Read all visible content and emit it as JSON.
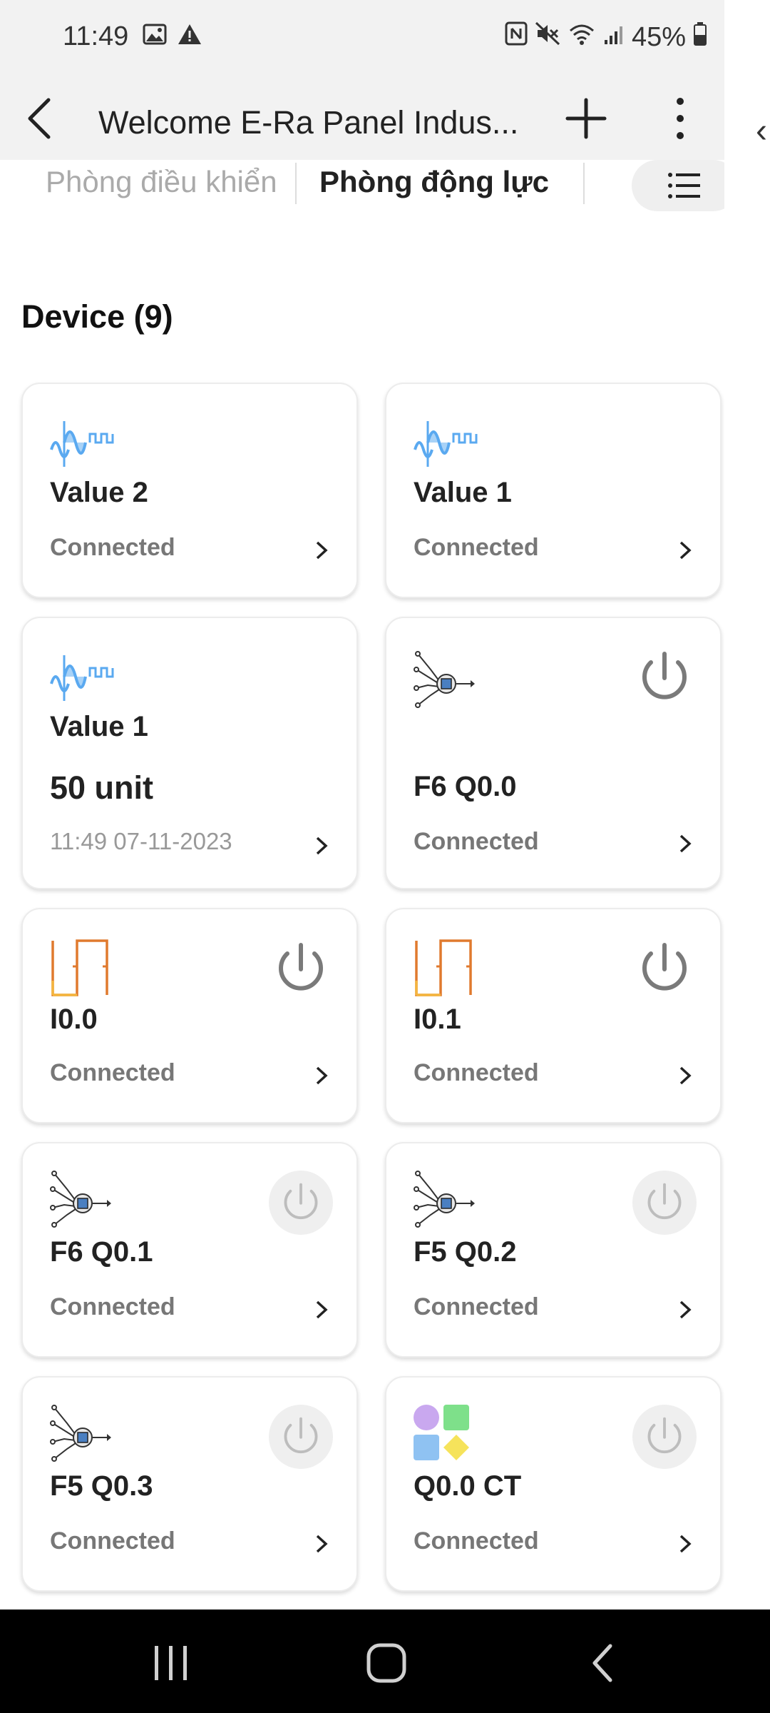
{
  "status_bar": {
    "time": "11:49",
    "battery": "45%"
  },
  "app_bar": {
    "title": "Welcome E-Ra Panel Indus..."
  },
  "tabs": [
    {
      "label": "Phòng điều khiển",
      "active": false
    },
    {
      "label": "Phòng động lực",
      "active": true
    }
  ],
  "section": {
    "title": "Device (9)"
  },
  "devices": [
    {
      "name": "Value 2",
      "status": "Connected",
      "icon": "wave-signal-icon"
    },
    {
      "name": "Value 1",
      "status": "Connected",
      "icon": "wave-signal-icon"
    },
    {
      "name": "Value 1",
      "value": "50 unit",
      "time": "11:49 07-11-2023",
      "icon": "wave-signal-icon"
    },
    {
      "name": "F6 Q0.0",
      "status": "Connected",
      "icon": "chip-circuit-icon",
      "power": "active"
    },
    {
      "name": "I0.0",
      "status": "Connected",
      "icon": "pulse-signal-icon",
      "power": "active"
    },
    {
      "name": "I0.1",
      "status": "Connected",
      "icon": "pulse-signal-icon",
      "power": "active"
    },
    {
      "name": "F6 Q0.1",
      "status": "Connected",
      "icon": "chip-circuit-icon",
      "power": "dim"
    },
    {
      "name": "F5 Q0.2",
      "status": "Connected",
      "icon": "chip-circuit-icon",
      "power": "dim"
    },
    {
      "name": "F5 Q0.3",
      "status": "Connected",
      "icon": "chip-circuit-icon",
      "power": "dim"
    },
    {
      "name": "Q0.0 CT",
      "status": "Connected",
      "icon": "shapes-grid-icon",
      "power": "dim"
    }
  ],
  "colors": {
    "header_bg": "#f2f2f2",
    "wave_blue": "#5aa9f0",
    "pulse_orange": "#e07a2e",
    "power_gray": "#7a7a7a"
  }
}
